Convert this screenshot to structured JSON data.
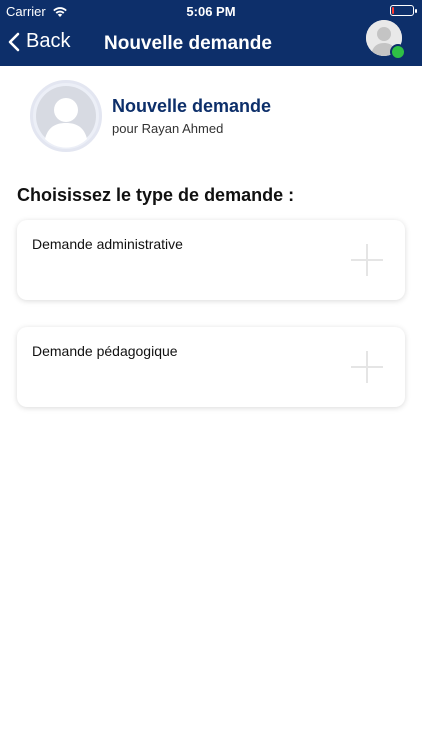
{
  "status_bar": {
    "carrier": "Carrier",
    "time": "5:06 PM",
    "battery_level": 0.1
  },
  "nav": {
    "back_label": "Back",
    "title": "Nouvelle demande"
  },
  "profile": {
    "title": "Nouvelle demande",
    "subtitle": "pour Rayan Ahmed"
  },
  "section": {
    "title": "Choisissez le type de demande :"
  },
  "request_types": [
    {
      "label": "Demande administrative",
      "icon": "plus-icon"
    },
    {
      "label": "Demande pédagogique",
      "icon": "plus-icon"
    }
  ],
  "colors": {
    "header": "#0d2f6a",
    "accent_title": "#0d2f6a",
    "online": "#2fbf45",
    "battery_low": "#ff3b30"
  }
}
